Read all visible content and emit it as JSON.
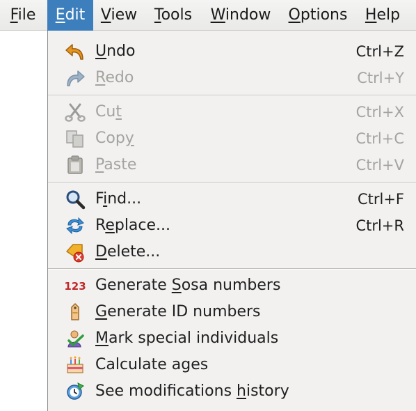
{
  "menubar": {
    "file": {
      "label": "File",
      "mnemonic": "F",
      "rest": "ile"
    },
    "edit": {
      "label": "Edit",
      "mnemonic": "E",
      "rest": "dit"
    },
    "view": {
      "label": "View",
      "mnemonic": "V",
      "rest": "iew"
    },
    "tools": {
      "label": "Tools",
      "mnemonic": "T",
      "rest": "ools"
    },
    "window": {
      "label": "Window",
      "mnemonic": "W",
      "rest": "indow"
    },
    "options": {
      "label": "Options",
      "mnemonic": "O",
      "rest": "ptions"
    },
    "help": {
      "label": "Help",
      "mnemonic": "H",
      "rest": "elp"
    },
    "active_color": "#3d7ebd"
  },
  "edit_menu": {
    "undo": {
      "pre": "",
      "mn": "U",
      "post": "ndo",
      "shortcut": "Ctrl+Z",
      "enabled": true,
      "icon": "undo-icon"
    },
    "redo": {
      "pre": "",
      "mn": "R",
      "post": "edo",
      "shortcut": "Ctrl+Y",
      "enabled": false,
      "icon": "redo-icon"
    },
    "cut": {
      "pre": "Cu",
      "mn": "t",
      "post": "",
      "shortcut": "Ctrl+X",
      "enabled": false,
      "icon": "scissors-icon"
    },
    "copy": {
      "pre": "Cop",
      "mn": "y",
      "post": "",
      "shortcut": "Ctrl+C",
      "enabled": false,
      "icon": "copy-icon"
    },
    "paste": {
      "pre": "",
      "mn": "P",
      "post": "aste",
      "shortcut": "Ctrl+V",
      "enabled": false,
      "icon": "clipboard-icon"
    },
    "find": {
      "pre": "F",
      "mn": "i",
      "post": "nd...",
      "shortcut": "Ctrl+F",
      "enabled": true,
      "icon": "magnifier-icon"
    },
    "replace": {
      "pre": "R",
      "mn": "e",
      "post": "place...",
      "shortcut": "Ctrl+R",
      "enabled": true,
      "icon": "replace-arrows-icon"
    },
    "delete": {
      "pre": "",
      "mn": "D",
      "post": "elete...",
      "shortcut": "",
      "enabled": true,
      "icon": "delete-tag-icon"
    },
    "sosa": {
      "pre": "Generate ",
      "mn": "S",
      "post": "osa numbers",
      "shortcut": "",
      "enabled": true,
      "icon": "numbers-123-icon",
      "icon_text": "123"
    },
    "gen_id": {
      "pre": "",
      "mn": "G",
      "post": "enerate ID numbers",
      "shortcut": "",
      "enabled": true,
      "icon": "id-tag-icon"
    },
    "mark_special": {
      "pre": "",
      "mn": "M",
      "post": "ark special individuals",
      "shortcut": "",
      "enabled": true,
      "icon": "person-check-icon"
    },
    "calc_ages": {
      "pre": "Calculate ages",
      "mn": "",
      "post": "",
      "shortcut": "",
      "enabled": true,
      "icon": "birthday-cake-icon"
    },
    "history": {
      "pre": "See modifications ",
      "mn": "h",
      "post": "istory",
      "shortcut": "",
      "enabled": true,
      "icon": "history-clock-icon"
    }
  }
}
